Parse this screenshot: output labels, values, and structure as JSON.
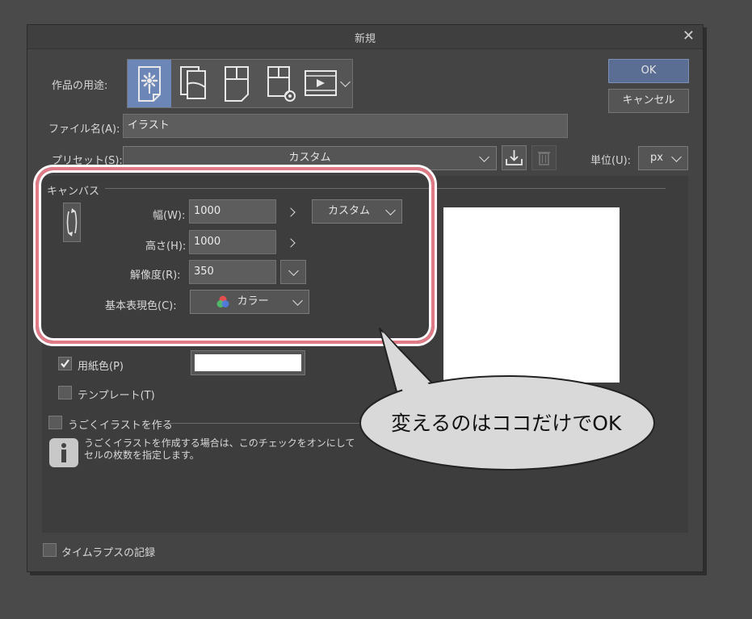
{
  "dialog": {
    "title": "新規",
    "ok_label": "OK",
    "cancel_label": "キャンセル",
    "purpose_label": "作品の用途:",
    "filename_label": "ファイル名(A):",
    "filename_value": "イラスト",
    "preset_label": "プリセット(S):",
    "preset_value": "カスタム",
    "unit_label": "単位(U):",
    "unit_value": "px"
  },
  "canvas": {
    "section_title": "キャンバス",
    "width_label": "幅(W):",
    "width_value": "1000",
    "height_label": "高さ(H):",
    "height_value": "1000",
    "resolution_label": "解像度(R):",
    "resolution_value": "350",
    "color_label": "基本表現色(C):",
    "color_value": "カラー",
    "size_preset_value": "カスタム"
  },
  "paper": {
    "paper_color_label": "用紙色(P)",
    "paper_color_checked": true,
    "paper_color_hex": "#ffffff",
    "template_label": "テンプレート(T)"
  },
  "animation": {
    "label": "うごくイラストを作る",
    "info_text_line1": "うごくイラストを作成する場合は、このチェックをオンにして",
    "info_text_line2": "セルの枚数を指定します。"
  },
  "timelapse": {
    "label": "タイムラプスの記録"
  },
  "callout": {
    "text": "変えるのはココだけでOK"
  },
  "colors": {
    "selected_tab": "#6c86b8",
    "ok_button": "#5a6e94",
    "highlight_border": "#e07a86"
  }
}
